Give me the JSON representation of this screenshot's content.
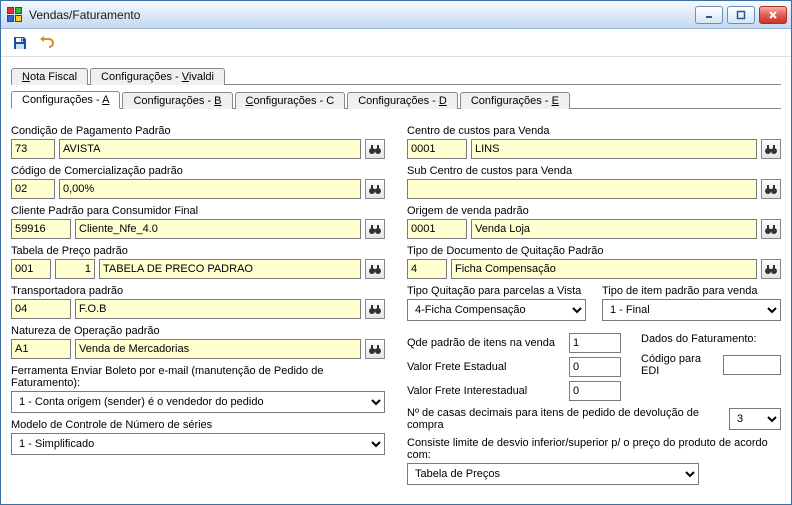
{
  "window": {
    "title": "Vendas/Faturamento"
  },
  "tabs1": [
    {
      "label": "Nota Fiscal",
      "accel": "N"
    },
    {
      "label": "Configurações - Vivaldi",
      "accel": "V"
    }
  ],
  "tabs2": [
    {
      "label": "Configurações - A",
      "accel": "A",
      "active": true
    },
    {
      "label": "Configurações - B",
      "accel": "B"
    },
    {
      "label": "Configurações - C",
      "accel": "C"
    },
    {
      "label": "Configurações - D",
      "accel": "D"
    },
    {
      "label": "Configurações - E",
      "accel": "E"
    }
  ],
  "left": {
    "cond_pag": {
      "label": "Condição de Pagamento Padrão",
      "code": "73",
      "desc": "AVISTA"
    },
    "cod_com": {
      "label": "Código de Comercialização padrão",
      "code": "02",
      "desc": "0,00%"
    },
    "cli_pad": {
      "label": "Cliente Padrão para Consumidor Final",
      "code": "59916",
      "desc": "Cliente_Nfe_4.0"
    },
    "tab_preco": {
      "label": "Tabela de Preço padrão",
      "code1": "001",
      "code2": "1",
      "desc": "TABELA DE PRECO PADRAO"
    },
    "transp": {
      "label": "Transportadora padrão",
      "code": "04",
      "desc": "F.O.B"
    },
    "nat_op": {
      "label": "Natureza de Operação padrão",
      "code": "A1",
      "desc": "Venda de Mercadorias"
    },
    "ferramenta": {
      "label": "Ferramenta Enviar Boleto por e-mail (manutenção de Pedido de Faturamento):",
      "value": "1 - Conta origem (sender) é o vendedor do pedido"
    },
    "modelo": {
      "label": "Modelo de Controle de Número de séries",
      "value": "1 - Simplificado"
    }
  },
  "right": {
    "centro": {
      "label": "Centro de custos para Venda",
      "code": "0001",
      "desc": "LINS"
    },
    "sub_centro": {
      "label": "Sub Centro de custos para Venda",
      "value": ""
    },
    "origem": {
      "label": "Origem de venda padrão",
      "code": "0001",
      "desc": "Venda Loja"
    },
    "tipo_doc": {
      "label": "Tipo de Documento de Quitação Padrão",
      "code": "4",
      "desc": "Ficha Compensação"
    },
    "tipo_quit": {
      "label": "Tipo Quitação para parcelas a Vista",
      "value": "4-Ficha Compensação"
    },
    "tipo_item": {
      "label": "Tipo de item padrão para venda",
      "value": "1 - Final"
    },
    "qde_itens": {
      "label": "Qde padrão de itens na venda",
      "value": "1"
    },
    "frete_est": {
      "label": "Valor Frete Estadual",
      "value": "0"
    },
    "frete_int": {
      "label": "Valor Frete Interestadual",
      "value": "0"
    },
    "dados_fat": {
      "label": "Dados do Faturamento:"
    },
    "codigo_edi": {
      "label": "Código para EDI",
      "value": ""
    },
    "casas": {
      "label": "Nº de casas decimais para itens de pedido de devolução de compra",
      "value": "3"
    },
    "consiste": {
      "label": "Consiste limite de desvio inferior/superior p/ o preço do produto de acordo com:",
      "value": "Tabela de Preços"
    }
  }
}
